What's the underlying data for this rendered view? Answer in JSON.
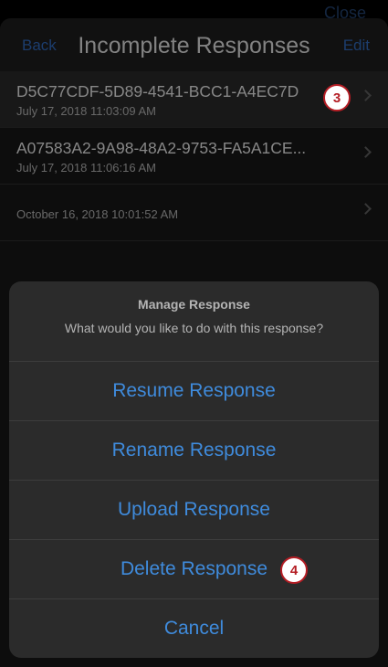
{
  "window": {
    "close_label": "Close"
  },
  "navbar": {
    "back_label": "Back",
    "title": "Incomplete Responses",
    "edit_label": "Edit"
  },
  "responses": [
    {
      "id": "D5C77CDF-5D89-4541-BCC1-A4EC7D",
      "date": "July 17, 2018 11:03:09 AM"
    },
    {
      "id": "A07583A2-9A98-48A2-9753-FA5A1CE...",
      "date": "July 17, 2018 11:06:16 AM"
    },
    {
      "id": "",
      "date": "October 16, 2018 10:01:52 AM"
    }
  ],
  "callouts": {
    "first": "3",
    "second": "4"
  },
  "action_sheet": {
    "title": "Manage Response",
    "message": "What would you like to do with this response?",
    "resume": "Resume Response",
    "rename": "Rename Response",
    "upload": "Upload Response",
    "delete": "Delete Response",
    "cancel": "Cancel"
  },
  "colors": {
    "accent": "#3f8bdc",
    "callout_border": "#b41d24"
  }
}
